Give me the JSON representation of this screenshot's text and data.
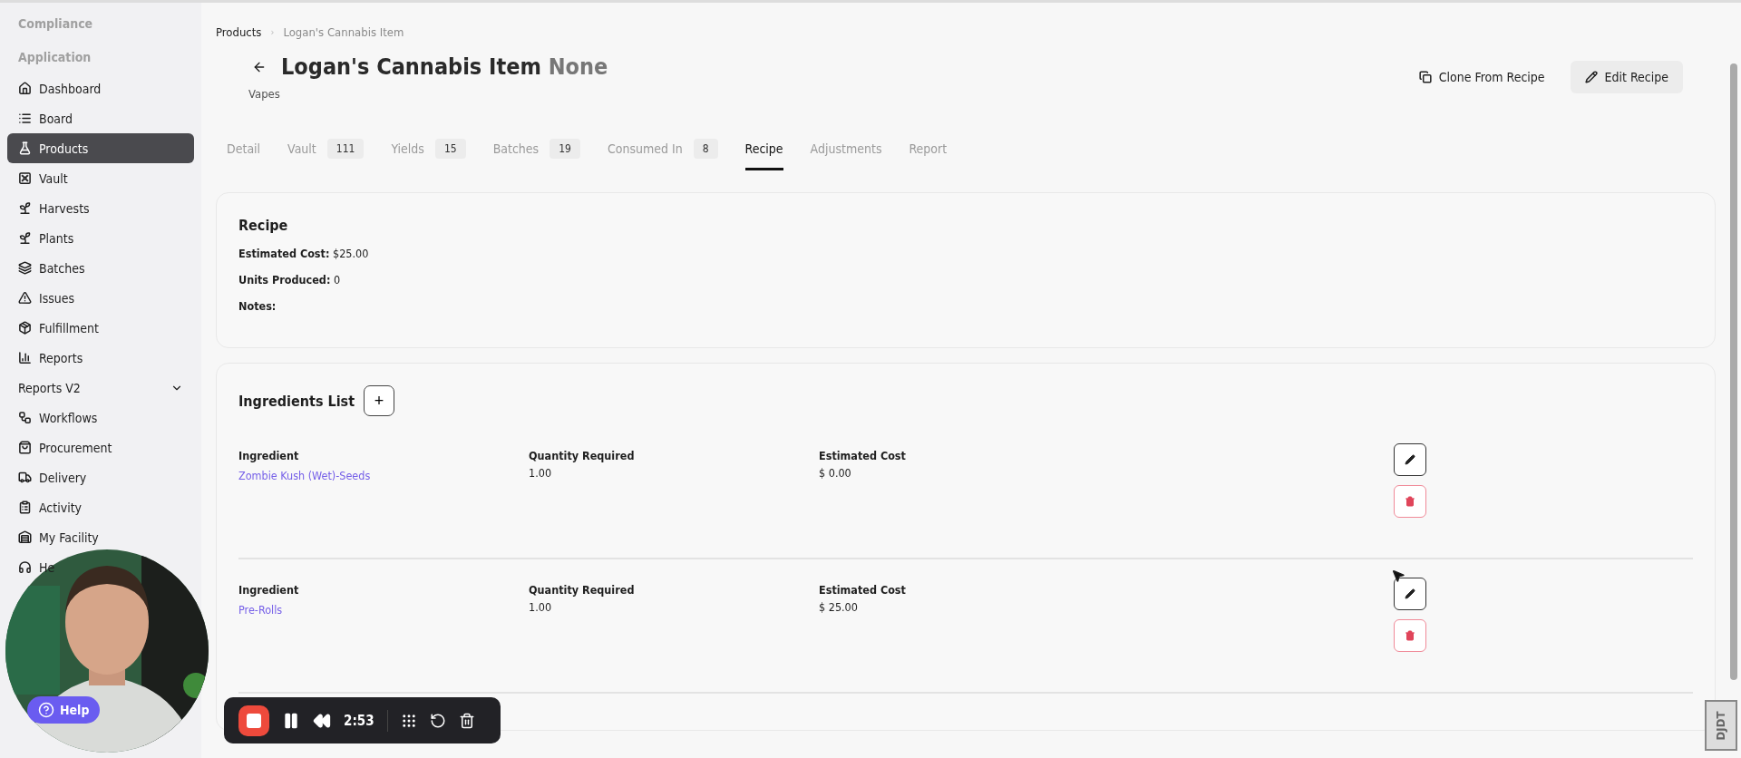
{
  "sidebar": {
    "sections": [
      "Compliance",
      "Application"
    ],
    "items": [
      {
        "label": "Dashboard",
        "kind": "link",
        "selected": false
      },
      {
        "label": "Board",
        "kind": "link",
        "selected": false
      },
      {
        "label": "Products",
        "kind": "link",
        "selected": true
      },
      {
        "label": "Vault",
        "kind": "link",
        "selected": false
      },
      {
        "label": "Harvests",
        "kind": "link",
        "selected": false
      },
      {
        "label": "Plants",
        "kind": "link",
        "selected": false
      },
      {
        "label": "Batches",
        "kind": "link",
        "selected": false
      },
      {
        "label": "Issues",
        "kind": "link",
        "selected": false
      },
      {
        "label": "Fulfillment",
        "kind": "link",
        "selected": false
      },
      {
        "label": "Reports",
        "kind": "link",
        "selected": false
      },
      {
        "label": "Reports V2",
        "kind": "group",
        "selected": false,
        "expanded": false
      },
      {
        "label": "Workflows",
        "kind": "link",
        "selected": false
      },
      {
        "label": "Procurement",
        "kind": "link",
        "selected": false
      },
      {
        "label": "Delivery",
        "kind": "link",
        "selected": false
      },
      {
        "label": "Activity",
        "kind": "link",
        "selected": false
      },
      {
        "label": "My Facility",
        "kind": "link",
        "selected": false
      },
      {
        "label": "He",
        "kind": "link",
        "selected": false
      }
    ]
  },
  "breadcrumb": {
    "items": [
      "Products",
      "Logan's Cannabis Item"
    ],
    "separator": "›"
  },
  "header": {
    "title": "Logan's Cannabis Item",
    "suffix": "None",
    "category": "Vapes",
    "actions": [
      {
        "label": "Clone From Recipe",
        "kind": "clone"
      },
      {
        "label": "Edit Recipe",
        "kind": "edit"
      }
    ]
  },
  "tabs": [
    {
      "label": "Detail",
      "selected": false
    },
    {
      "label": "Vault",
      "count": "111",
      "selected": false
    },
    {
      "label": "Yields",
      "count": "15",
      "selected": false
    },
    {
      "label": "Batches",
      "count": "19",
      "selected": false
    },
    {
      "label": "Consumed In",
      "count": "8",
      "selected": false
    },
    {
      "label": "Recipe",
      "selected": true
    },
    {
      "label": "Adjustments",
      "selected": false
    },
    {
      "label": "Report",
      "selected": false
    }
  ],
  "recipe": {
    "title": "Recipe",
    "fields": [
      {
        "label": "Estimated Cost:",
        "value": "$25.00"
      },
      {
        "label": "Units Produced:",
        "value": "0"
      },
      {
        "label": "Notes:"
      }
    ]
  },
  "ingredients": {
    "title": "Ingredients List",
    "add": "+",
    "rows": [
      {
        "columns": [
          "Ingredient",
          "Quantity Required",
          "Estimated Cost"
        ],
        "ingredient": "Zombie Kush (Wet)-Seeds",
        "quantity": "1.00",
        "cost": "$ 0.00"
      },
      {
        "columns": [
          "Ingredient",
          "Quantity Required",
          "Estimated Cost"
        ],
        "ingredient": "Pre-Rolls",
        "quantity": "1.00",
        "cost": "$ 25.00"
      }
    ]
  },
  "help": "Help",
  "recorder": {
    "time": "2:53"
  },
  "debug_toolbar": "DJDT"
}
